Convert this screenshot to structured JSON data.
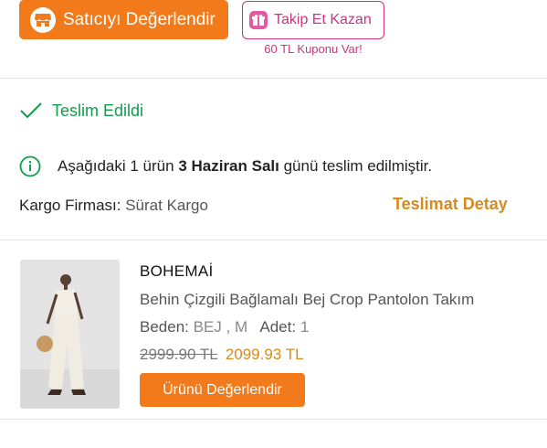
{
  "actions": {
    "rate_seller_label": "Satıcıyı Değerlendir",
    "follow_label": "Takip Et Kazan",
    "coupon_note": "60 TL Kuponu Var!"
  },
  "status": {
    "delivered_label": "Teslim Edildi",
    "info_prefix": "Aşağıdaki 1 ürün ",
    "info_date": "3 Haziran Salı",
    "info_suffix": " günü teslim edilmiştir."
  },
  "cargo": {
    "label": "Kargo Firması:",
    "value": "Sürat Kargo",
    "detail_link": "Teslimat Detay"
  },
  "product": {
    "brand": "BOHEMAİ",
    "name": "Behin Çizgili Bağlamalı Bej Crop Pantolon Takım",
    "size_label": "Beden:",
    "size_value": "BEJ , M",
    "qty_label": "Adet:",
    "qty_value": "1",
    "old_price": "2999.90 TL",
    "new_price": "2099.93 TL",
    "rate_button": "Ürünü Değerlendir"
  },
  "colors": {
    "brand_orange": "#f27a1a",
    "pink": "#c9357e",
    "success_green": "#0e9e4d",
    "price_gold": "#d58b1e"
  },
  "icons": [
    "store-icon",
    "gift-icon",
    "check-icon",
    "info-icon"
  ]
}
